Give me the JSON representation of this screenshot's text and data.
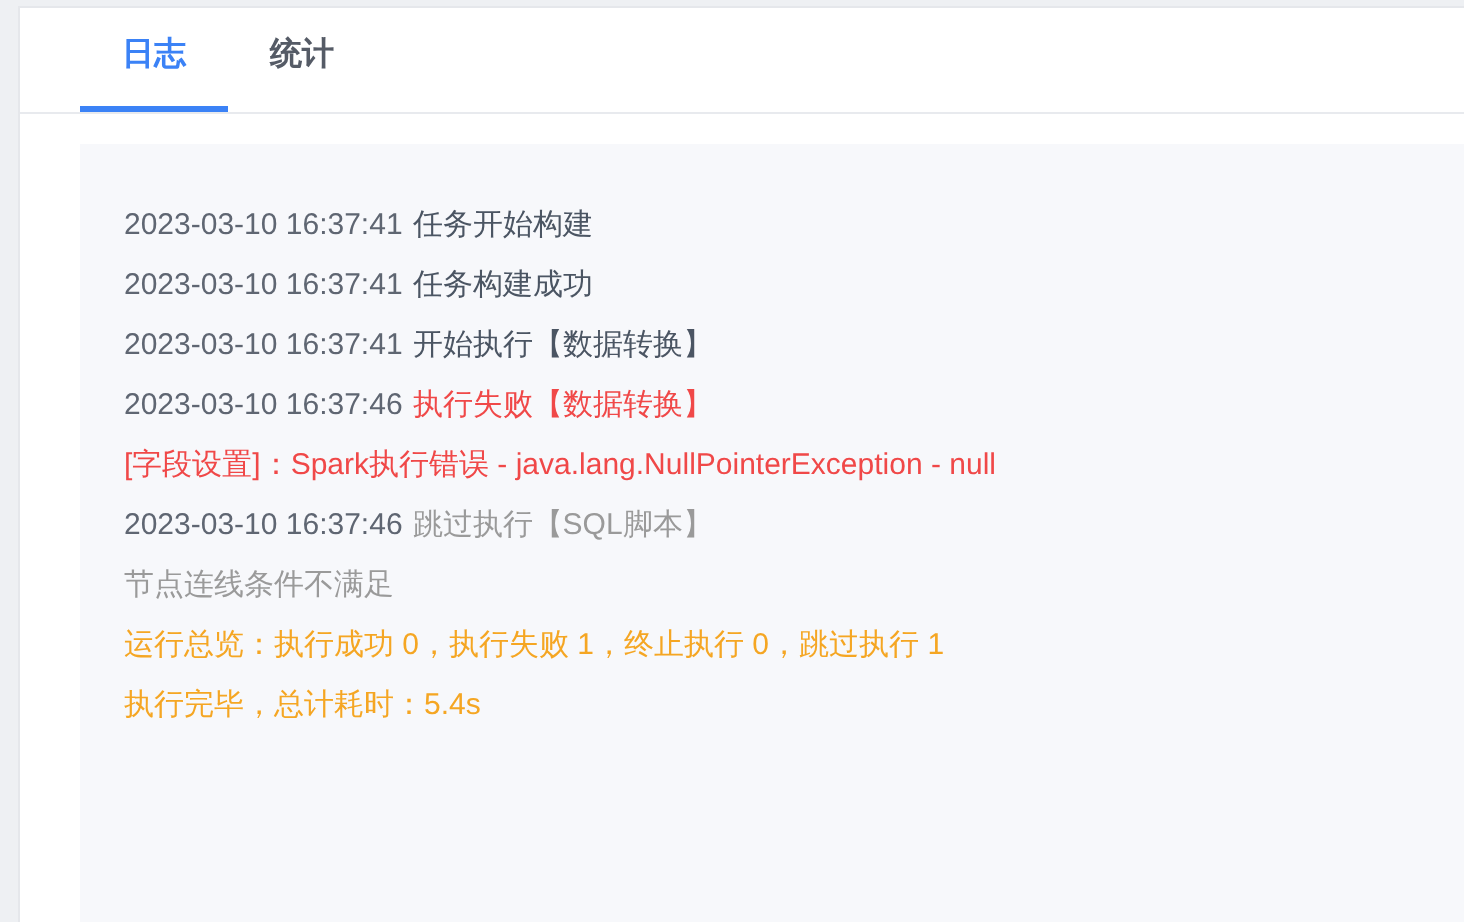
{
  "tabs": [
    {
      "label": "日志",
      "selected": true
    },
    {
      "label": "统计",
      "selected": false
    }
  ],
  "log": [
    {
      "time": "2023-03-10 16:37:41",
      "message": "任务开始构建",
      "kind": "normal"
    },
    {
      "time": "2023-03-10 16:37:41",
      "message": "任务构建成功",
      "kind": "normal"
    },
    {
      "time": "2023-03-10 16:37:41",
      "message": "开始执行【数据转换】",
      "kind": "normal"
    },
    {
      "time": "2023-03-10 16:37:46",
      "message": "执行失败【数据转换】",
      "kind": "error"
    },
    {
      "message": "[字段设置]：Spark执行错误 - java.lang.NullPointerException - null",
      "kind": "error"
    },
    {
      "time": "2023-03-10 16:37:46",
      "message": "跳过执行【SQL脚本】",
      "kind": "skipped"
    },
    {
      "message": "节点连线条件不满足",
      "kind": "skipped"
    },
    {
      "message": "运行总览：执行成功 0，执行失败 1，终止执行 0，跳过执行 1",
      "kind": "summary"
    },
    {
      "message": "执行完毕，总计耗时：5.4s",
      "kind": "summary"
    }
  ]
}
